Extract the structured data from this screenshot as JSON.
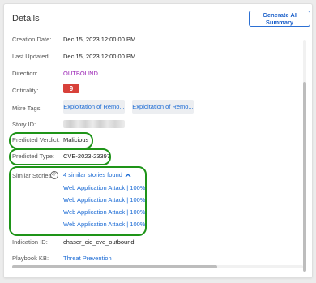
{
  "header": {
    "title": "Details",
    "generate_button": "Generate AI Summary"
  },
  "fields": {
    "creation_date": {
      "label": "Creation Date:",
      "value": "Dec 15, 2023 12:00:00 PM"
    },
    "last_updated": {
      "label": "Last Updated:",
      "value": "Dec 15, 2023 12:00:00 PM"
    },
    "direction": {
      "label": "Direction:",
      "value": "OUTBOUND",
      "color": "#9b25b5"
    },
    "criticality": {
      "label": "Criticality:",
      "value": "9",
      "color": "#d8413a"
    },
    "mitre_tags": {
      "label": "Mitre Tags:",
      "tags": [
        "Exploitation of Remo...",
        "Exploitation of Remo..."
      ]
    },
    "story_id": {
      "label": "Story ID:"
    },
    "predicted_verdict": {
      "label": "Predicted Verdict:",
      "value": "Malicious"
    },
    "predicted_type": {
      "label": "Predicted Type:",
      "value": "CVE-2023-23397"
    },
    "similar_stories": {
      "label": "Similar Stories:",
      "help_icon": "question-circle-icon",
      "toggle_label": "4 similar stories found",
      "toggle_icon": "chevron-up-icon",
      "items": [
        "Web Application Attack | 100%",
        "Web Application Attack | 100%",
        "Web Application Attack | 100%",
        "Web Application Attack | 100%"
      ]
    },
    "indication_id": {
      "label": "Indication ID:",
      "value": "chaser_cid_cve_outbound"
    },
    "playbook_kb": {
      "label": "Playbook KB:",
      "value": "Threat Prevention"
    }
  },
  "colors": {
    "accent": "#1a6ad4",
    "highlight": "#1e9418"
  }
}
